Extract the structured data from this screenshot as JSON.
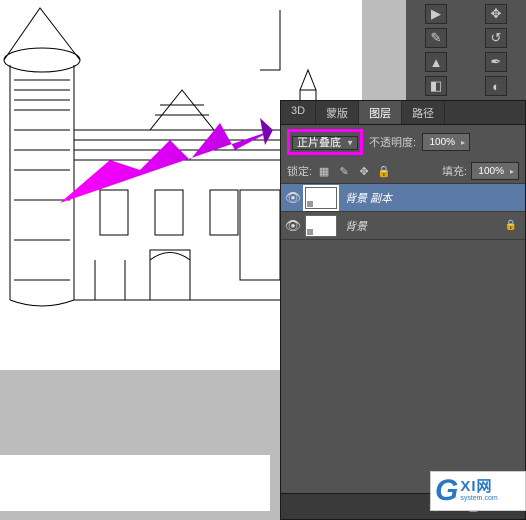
{
  "panel": {
    "tabs": [
      "3D",
      "蒙版",
      "图层",
      "路径"
    ],
    "activeTab": 2
  },
  "blend": {
    "mode": "正片叠底",
    "opacityLabel": "不透明度:",
    "opacityValue": "100%",
    "lockLabel": "锁定:",
    "fillLabel": "填充:",
    "fillValue": "100%"
  },
  "layers": [
    {
      "name": "背景 副本",
      "visible": true,
      "selected": true,
      "locked": false
    },
    {
      "name": "背景",
      "visible": true,
      "selected": false,
      "locked": true
    }
  ],
  "watermark": {
    "letter": "G",
    "line1": "XI网",
    "line2": "system.com"
  }
}
